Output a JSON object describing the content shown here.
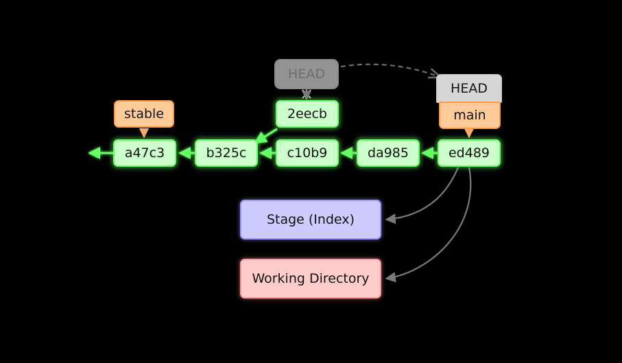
{
  "diagram": {
    "title": "git repository state diagram",
    "background_color": "#000000",
    "colors": {
      "commit_fill": "#ccffcc",
      "commit_border": "#66ff66",
      "branch_fill": "#ffcc99",
      "branch_border": "#ff9944",
      "head_fill": "#d6d6d6",
      "head_ghost_fill": "#ededed",
      "head_ghost_text": "#b0b0b0",
      "stage_fill": "#ccccff",
      "stage_border": "#9999ff",
      "working_fill": "#ffcccc",
      "working_border": "#ff9999",
      "edge_gray": "#7a7a7a",
      "text": "#111111"
    }
  },
  "commits": [
    {
      "id": "c0",
      "label": "a47c3"
    },
    {
      "id": "c1",
      "label": "b325c"
    },
    {
      "id": "c2",
      "label": "c10b9"
    },
    {
      "id": "c3",
      "label": "da985"
    },
    {
      "id": "c4",
      "label": "ed489"
    },
    {
      "id": "c5",
      "label": "2eecb"
    }
  ],
  "branches": [
    {
      "id": "stable",
      "label": "stable",
      "points_to": "a47c3"
    },
    {
      "id": "main",
      "label": "main",
      "points_to": "ed489"
    }
  ],
  "head": {
    "current_label": "HEAD",
    "current_attached_to": "main",
    "previous_label": "HEAD",
    "previous_pointed_to": "2eecb",
    "moved": true,
    "detached_marker": "x"
  },
  "areas": [
    {
      "id": "stage",
      "label": "Stage (Index)"
    },
    {
      "id": "working",
      "label": "Working Directory"
    }
  ],
  "edges": [
    {
      "from": "b325c",
      "to": "a47c3",
      "kind": "parent",
      "color": "green"
    },
    {
      "from": "c10b9",
      "to": "b325c",
      "kind": "parent",
      "color": "green"
    },
    {
      "from": "da985",
      "to": "c10b9",
      "kind": "parent",
      "color": "green"
    },
    {
      "from": "ed489",
      "to": "da985",
      "kind": "parent",
      "color": "green"
    },
    {
      "from": "a47c3",
      "to": "older-history",
      "kind": "parent",
      "color": "green"
    },
    {
      "from": "2eecb",
      "to": "b325c",
      "kind": "parent",
      "color": "green"
    },
    {
      "from": "stable",
      "to": "a47c3",
      "kind": "branch-pointer",
      "color": "orange"
    },
    {
      "from": "main",
      "to": "ed489",
      "kind": "branch-pointer",
      "color": "orange"
    },
    {
      "from": "HEAD-previous",
      "to": "HEAD-current",
      "kind": "head-move",
      "color": "gray",
      "style": "dashed"
    },
    {
      "from": "ed489",
      "to": "stage",
      "kind": "checkout",
      "color": "gray"
    },
    {
      "from": "ed489",
      "to": "working",
      "kind": "checkout",
      "color": "gray"
    }
  ]
}
